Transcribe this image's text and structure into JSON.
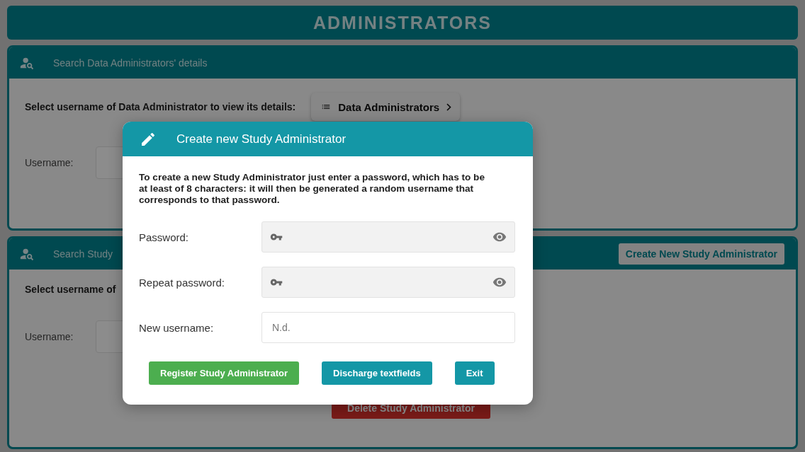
{
  "page_title": "ADMINISTRATORS",
  "panels": [
    {
      "title": "Search Data Administrators' details",
      "select_label": "Select username of Data Administrator to view its details:",
      "dropdown": "Data Administrators",
      "username_label": "Username:"
    },
    {
      "title": "Search Study",
      "action_button": "Create New Study Administrator",
      "select_label": "Select username of",
      "username_label": "Username:",
      "delete_button": "Delete Study Administrator"
    }
  ],
  "dialog": {
    "title": "Create new Study Administrator",
    "message": "To create a new Study Administrator just enter a password, which has to be at least of 8 characters: it will then be generated a random username that corresponds to that password.",
    "fields": [
      {
        "label": "Password:",
        "kind": "password"
      },
      {
        "label": "Repeat password:",
        "kind": "password"
      },
      {
        "label": "New username:",
        "kind": "text",
        "placeholder": "N.d."
      }
    ],
    "buttons": [
      {
        "label": "Register Study Administrator",
        "color": "#4cae4f"
      },
      {
        "label": "Discharge textfields",
        "color": "#1497a6"
      },
      {
        "label": "Exit",
        "color": "#1497a6"
      }
    ]
  }
}
